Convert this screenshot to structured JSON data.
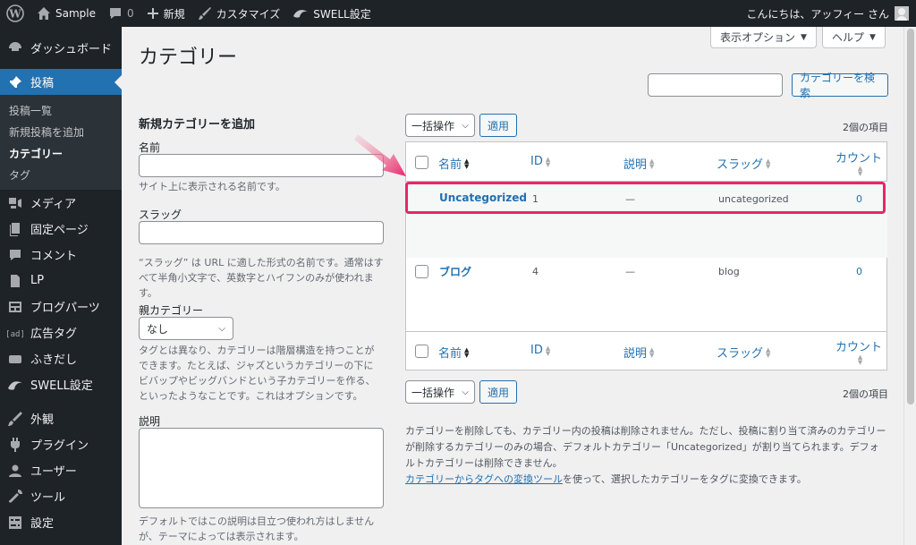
{
  "adminbar": {
    "site_name": "Sample",
    "comments_count": "0",
    "new_label": "新規",
    "customize_label": "カスタマイズ",
    "swell_label": "SWELL設定",
    "greeting": "こんにちは、アッフィー さん"
  },
  "sidebar": {
    "items": [
      {
        "label": "ダッシュボード",
        "icon": "dashboard-icon"
      },
      {
        "label": "投稿",
        "icon": "pushpin-icon"
      },
      {
        "label": "メディア",
        "icon": "media-icon"
      },
      {
        "label": "固定ページ",
        "icon": "page-icon"
      },
      {
        "label": "コメント",
        "icon": "comment-icon"
      },
      {
        "label": "LP",
        "icon": "document-icon"
      },
      {
        "label": "ブログパーツ",
        "icon": "layout-icon"
      },
      {
        "label": "広告タグ",
        "icon": "ad-icon"
      },
      {
        "label": "ふきだし",
        "icon": "balloon-icon"
      },
      {
        "label": "SWELL設定",
        "icon": "swell-icon"
      },
      {
        "label": "外観",
        "icon": "brush-icon"
      },
      {
        "label": "プラグイン",
        "icon": "plugin-icon"
      },
      {
        "label": "ユーザー",
        "icon": "user-icon"
      },
      {
        "label": "ツール",
        "icon": "wrench-icon"
      },
      {
        "label": "設定",
        "icon": "settings-icon"
      }
    ],
    "submenu": [
      "投稿一覧",
      "新規投稿を追加",
      "カテゴリー",
      "タグ"
    ]
  },
  "header": {
    "title": "カテゴリー",
    "screen_options": "表示オプション",
    "help": "ヘルプ",
    "search_button": "カテゴリーを検索"
  },
  "form": {
    "heading": "新規カテゴリーを追加",
    "name_label": "名前",
    "name_desc": "サイト上に表示される名前です。",
    "slug_label": "スラッグ",
    "slug_desc_1": "“スラッグ” は URL に適した形式の名前です。通常はす",
    "slug_desc_2": "べて半角小文字で、英数字とハイフンのみが使われま",
    "slug_desc_3": "す。",
    "parent_label": "親カテゴリー",
    "parent_value": "なし",
    "parent_desc_1": "タグとは異なり、カテゴリーは階層構造を持つことが",
    "parent_desc_2": "できます。たとえば、ジャズというカテゴリーの下に",
    "parent_desc_3": "ビバップやビッグバンドという子カテゴリーを作る、",
    "parent_desc_4": "といったようなことです。これはオプションです。",
    "desc_label": "説明",
    "desc_desc_1": "デフォルトではこの説明は目立つ使われ方はしません",
    "desc_desc_2": "が、テーマによっては表示されます。"
  },
  "table": {
    "bulk_action": "一括操作",
    "apply": "適用",
    "item_count": "2個の項目",
    "columns": {
      "name": "名前",
      "id": "ID",
      "description": "説明",
      "slug": "スラッグ",
      "count": "カウント"
    },
    "rows": [
      {
        "name": "Uncategorized",
        "id": "1",
        "description": "—",
        "slug": "uncategorized",
        "count": "0"
      },
      {
        "name": "ブログ",
        "id": "4",
        "description": "—",
        "slug": "blog",
        "count": "0"
      }
    ]
  },
  "notes": {
    "line1": "カテゴリーを削除しても、カテゴリー内の投稿は削除されません。ただし、投稿に割り当て済みのカテゴリー",
    "line2": "が削除するカテゴリーのみの場合、デフォルトカテゴリー「Uncategorized」が割り当てられます。デフォ",
    "line3": "ルトカテゴリーは削除できません。",
    "converter_link": "カテゴリーからタグへの変換ツール",
    "converter_rest": "を使って、選択したカテゴリーをタグに変換できます。"
  },
  "colors": {
    "highlight": "#e8256a",
    "arrow": "#e8256a",
    "accent": "#2271b1"
  }
}
